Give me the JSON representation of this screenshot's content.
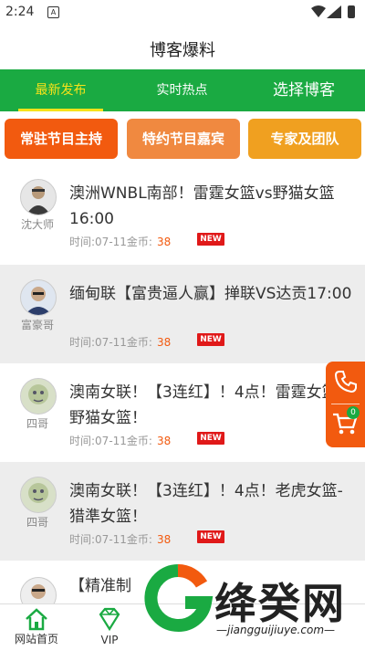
{
  "status_bar": {
    "time": "2:24",
    "sim_label": "A"
  },
  "header": {
    "title": "博客爆料"
  },
  "tabs": [
    {
      "label": "最新发布",
      "active": true
    },
    {
      "label": "实时热点",
      "active": false
    },
    {
      "label": "选择博客",
      "active": false
    }
  ],
  "categories": [
    {
      "label": "常驻节目主持"
    },
    {
      "label": "特约节目嘉宾"
    },
    {
      "label": "专家及团队"
    }
  ],
  "posts": [
    {
      "author": "沈大师",
      "title": "澳洲WNBL南部！雷霆女篮vs野猫女篮16:00",
      "time_label": "时间:",
      "date": "07-11",
      "coin_label": "金币:",
      "coins": "38",
      "badge": "NEW",
      "highlighted": false
    },
    {
      "author": "富豪哥",
      "title": "缅甸联【富贵逼人赢】掸联VS达贡17:00",
      "time_label": "时间:",
      "date": "07-11",
      "coin_label": "金币:",
      "coins": "38",
      "badge": "NEW",
      "highlighted": true
    },
    {
      "author": "四哥",
      "title": "澳南女联！【3连红】！4点！雷霆女篮-野猫女篮！",
      "time_label": "时间:",
      "date": "07-11",
      "coin_label": "金币:",
      "coins": "38",
      "badge": "NEW",
      "highlighted": false
    },
    {
      "author": "四哥",
      "title": "澳南女联！【3连红】！4点！老虎女篮-猎準女篮！",
      "time_label": "时间:",
      "date": "07-11",
      "coin_label": "金币:",
      "coins": "38",
      "badge": "NEW",
      "highlighted": true
    },
    {
      "author": "",
      "title": "【精准制",
      "time_label": "",
      "date": "",
      "coin_label": "",
      "coins": "",
      "badge": "",
      "highlighted": false
    }
  ],
  "float_bar": {
    "cart_count": "0"
  },
  "bottom_nav": [
    {
      "label": "网站首页",
      "icon": "home-icon"
    },
    {
      "label": "VIP",
      "icon": "diamond-icon"
    }
  ],
  "watermark": {
    "text": "绛癸网",
    "url": "—jiangguijiuye.com—"
  },
  "colors": {
    "brand_green": "#1aaa42",
    "accent_orange": "#f25a0f",
    "tab_active": "#f7e21a",
    "badge_red": "#e01919"
  }
}
